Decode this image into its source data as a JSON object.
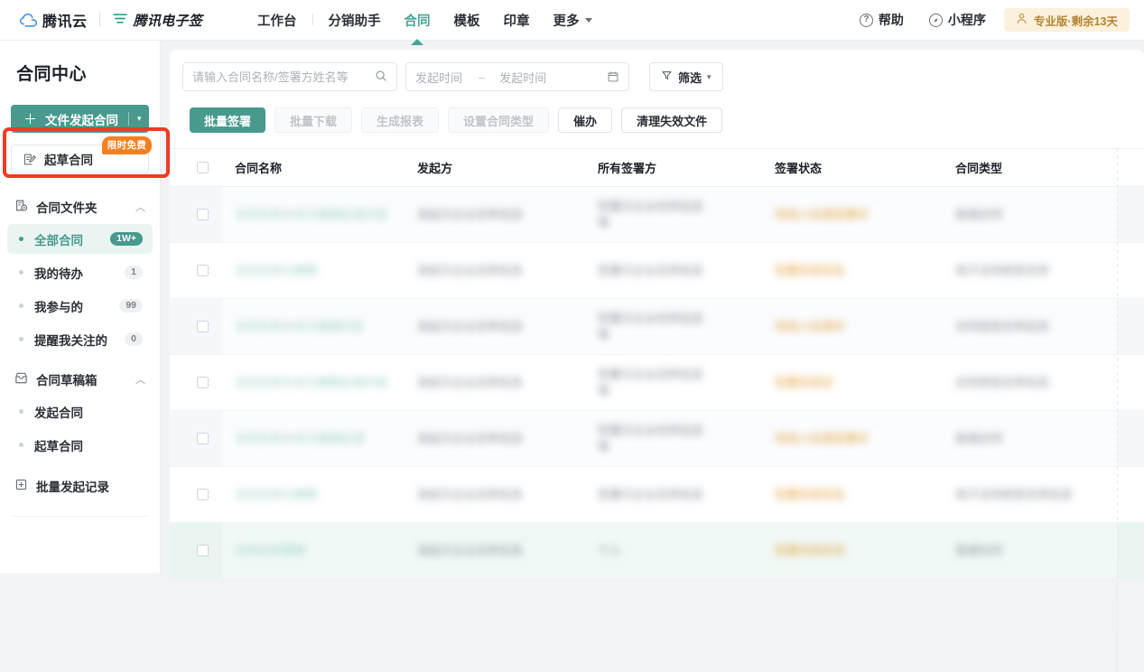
{
  "topbar": {
    "brand_cloud": "腾讯云",
    "brand_esign": "腾讯电子签",
    "nav": [
      {
        "label": "工作台",
        "active": false
      },
      {
        "label": "分销助手",
        "active": false
      },
      {
        "label": "合同",
        "active": true
      },
      {
        "label": "模板",
        "active": false
      },
      {
        "label": "印章",
        "active": false
      },
      {
        "label": "更多",
        "active": false,
        "caret": true
      }
    ],
    "help_label": "帮助",
    "help_icon": "question-circle-icon",
    "miniapp_label": "小程序",
    "miniapp_icon": "compass-icon",
    "vip_label": "专业版·剩余13天",
    "vip_icon": "user-crown-icon",
    "vip_bg": "#fbf1dd",
    "vip_color": "#b58432"
  },
  "sidebar": {
    "title": "合同中心",
    "primary_button": {
      "label": "文件发起合同",
      "plus": "＋",
      "caret": "▾"
    },
    "draft_button": {
      "label": "起草合同",
      "badge": "限时免费",
      "icon": "draft-edit-icon"
    },
    "groups": [
      {
        "label": "合同文件夹",
        "icon": "folder-contract-icon",
        "chevron": "︿",
        "items": [
          {
            "label": "全部合同",
            "badge": "1W+",
            "active": true
          },
          {
            "label": "我的待办",
            "badge": "1",
            "active": false
          },
          {
            "label": "我参与的",
            "badge": "99",
            "active": false
          },
          {
            "label": "提醒我关注的",
            "badge": "0",
            "active": false
          }
        ]
      },
      {
        "label": "合同草稿箱",
        "icon": "drawer-icon",
        "chevron": "︿",
        "items": [
          {
            "label": "发起合同",
            "badge": "",
            "active": false
          },
          {
            "label": "起草合同",
            "badge": "",
            "active": false
          }
        ]
      }
    ],
    "batch_record": {
      "label": "批量发起记录",
      "icon": "batch-box-icon"
    },
    "accent_color": "#479a8d",
    "highlight_box_color": "#ef3b22"
  },
  "toolbar": {
    "search_placeholder": "请输入合同名称/签署方姓名等",
    "search_value": "",
    "search_icon": "search-icon",
    "date_start_placeholder": "发起时间",
    "date_end_placeholder": "发起时间",
    "date_separator": "–",
    "calendar_icon": "calendar-icon",
    "filter_label": "筛选",
    "filter_icon": "funnel-icon",
    "filter_caret": "▾"
  },
  "actions": [
    {
      "label": "批量签署",
      "state": "primary"
    },
    {
      "label": "批量下载",
      "state": "disabled"
    },
    {
      "label": "生成报表",
      "state": "disabled"
    },
    {
      "label": "设置合同类型",
      "state": "disabled"
    },
    {
      "label": "催办",
      "state": "outline"
    },
    {
      "label": "清理失效文件",
      "state": "outline"
    }
  ],
  "table": {
    "columns": [
      "合同名称",
      "发起方",
      "所有签署方",
      "签署状态",
      "合同类型"
    ],
    "select_all_checkbox": false,
    "rows": [
      {
        "name": "合同名称文本已模糊处理内容",
        "initiator": "发起方企业名称信息",
        "signers": "签署方企业名称信息\n等",
        "status": "待他人处理签署中",
        "type": "普通合同",
        "highlight": "alt"
      },
      {
        "name": "合同名称已模糊",
        "initiator": "发起方企业名称信息",
        "signers": "签署方企业名称信息",
        "status": "签署完成状态",
        "type": "电子合同类型名称",
        "highlight": "none"
      },
      {
        "name": "合同名称文本已模糊内容",
        "initiator": "发起方企业名称信息",
        "signers": "签署方企业名称信息\n等",
        "status": "待他人处理中",
        "type": "合同类型名称信息",
        "highlight": "alt"
      },
      {
        "name": "合同名称文本已模糊处理内容",
        "initiator": "发起方企业名称信息",
        "signers": "签署方企业名称信息\n等",
        "status": "签署完成状",
        "type": "合同类型名称信息",
        "highlight": "none"
      },
      {
        "name": "合同名称文本已模糊处理",
        "initiator": "发起方企业名称信息",
        "signers": "签署方企业名称信息\n等",
        "status": "待他人处理签署中",
        "type": "普通合同",
        "highlight": "alt"
      },
      {
        "name": "合同名称已模糊",
        "initiator": "发起方企业名称信息",
        "signers": "签署方企业名称信息",
        "status": "签署完成状态",
        "type": "电子合同类型名称信息",
        "highlight": "none"
      },
      {
        "name": "合同名称模糊",
        "initiator": "发起方企业名称信息",
        "signers": "个人",
        "status": "签署完成状态",
        "type": "普通合同",
        "highlight": "hov"
      }
    ]
  }
}
